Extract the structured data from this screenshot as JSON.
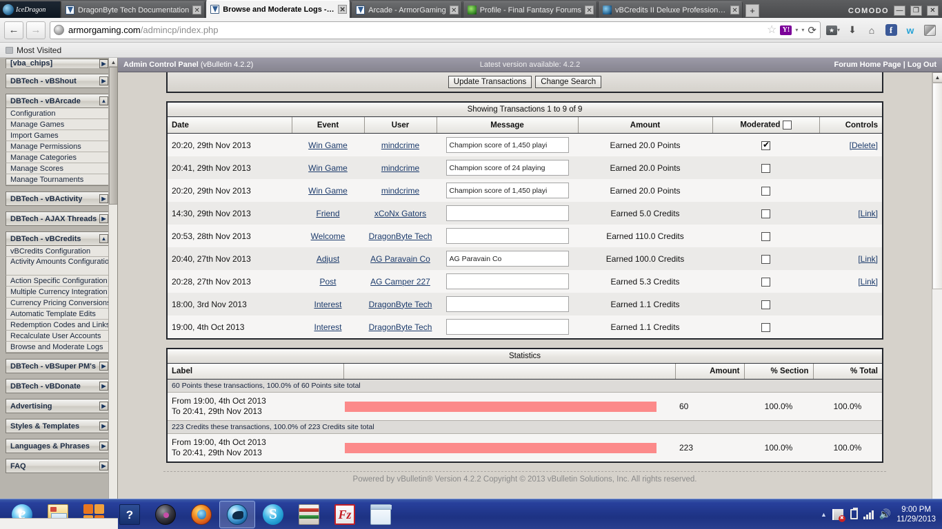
{
  "browser": {
    "brand_tab_label": "IceDragon",
    "tabs": [
      {
        "label": "DragonByte Tech Documentation",
        "favicon": "vbulletin-favicon",
        "active": false,
        "close_label": "✕"
      },
      {
        "label": "Browse and Moderate Logs - A...",
        "favicon": "vbulletin-favicon",
        "active": true,
        "close_label": "✕"
      },
      {
        "label": "Arcade - ArmorGaming",
        "favicon": "vbulletin-favicon",
        "active": false,
        "close_label": "✕"
      },
      {
        "label": "Profile - Final Fantasy Forums",
        "favicon": "green-globe-favicon",
        "active": false,
        "close_label": "✕"
      },
      {
        "label": "vBCredits II Deluxe Professional S...",
        "favicon": "blue-dragon-favicon",
        "active": false,
        "close_label": "✕"
      }
    ],
    "new_tab_label": "+",
    "comodo_label": "COMODO",
    "window_buttons": {
      "minimize": "—",
      "maximize": "❐",
      "close": "✕"
    },
    "nav": {
      "back_label": "←",
      "forward_label": "→",
      "url_domain": "armorgaming.com",
      "url_path": "/admincp/index.php",
      "star_label": "☆",
      "yahoo_label": "Y!",
      "caret_label": "▾",
      "reload_label": "⟳",
      "bookmarks_label": "★",
      "download_label": "⬇",
      "home_label": "⌂",
      "facebook_label": "f",
      "w_label": "w"
    },
    "bookmarks_bar": {
      "most_visited_label": "Most Visited"
    }
  },
  "acp": {
    "title_bold": "Admin Control Panel",
    "title_version": " (vBulletin 4.2.2)",
    "latest_version": "Latest version available: 4.2.2",
    "links_right": "Forum Home Page | Log Out"
  },
  "sidebar": {
    "clipped_top_label": "[vba_chips]",
    "blocks": [
      {
        "title": "DBTech - vBShout",
        "expanded": false,
        "arrow": "▶",
        "items": []
      },
      {
        "title": "DBTech - vBArcade",
        "expanded": true,
        "arrow": "▲",
        "items": [
          "Configuration",
          "Manage Games",
          "Import Games",
          "Manage Permissions",
          "Manage Categories",
          "Manage Scores",
          "Manage Tournaments"
        ]
      },
      {
        "title": "DBTech - vBActivity",
        "expanded": false,
        "arrow": "▶",
        "items": []
      },
      {
        "title": "DBTech - AJAX Threads",
        "expanded": false,
        "arrow": "▶",
        "items": []
      },
      {
        "title": "DBTech - vBCredits",
        "expanded": true,
        "arrow": "▲",
        "items": [
          "vBCredits Configuration",
          "Activity Amounts Configuration",
          "Action Specific Configuration",
          "Multiple Currency Integration",
          "Currency Pricing Conversions",
          "Automatic Template Edits",
          "Redemption Codes and Links",
          "Recalculate User Accounts",
          "Browse and Moderate Logs"
        ]
      },
      {
        "title": "DBTech - vBSuper PM's",
        "expanded": false,
        "arrow": "▶",
        "items": []
      },
      {
        "title": "DBTech - vBDonate",
        "expanded": false,
        "arrow": "▶",
        "items": []
      },
      {
        "title": "Advertising",
        "expanded": false,
        "arrow": "▶",
        "items": []
      },
      {
        "title": "Styles & Templates",
        "expanded": false,
        "arrow": "▶",
        "items": []
      },
      {
        "title": "Languages & Phrases",
        "expanded": false,
        "arrow": "▶",
        "items": []
      },
      {
        "title": "FAQ",
        "expanded": false,
        "arrow": "▶",
        "items": []
      }
    ]
  },
  "toolbar": {
    "update_transactions_label": "Update Transactions",
    "change_search_label": "Change Search"
  },
  "transactions": {
    "caption": "Showing Transactions 1 to 9 of 9",
    "columns": [
      "Date",
      "Event",
      "User",
      "Message",
      "Amount",
      "Moderated",
      "Controls"
    ],
    "rows": [
      {
        "date": "20:20, 29th Nov 2013",
        "event": "Win Game",
        "user": "mindcrime",
        "message": "Champion score of 1,450 playi",
        "amount": "Earned 20.0 Points",
        "moderated": true,
        "control": "[Delete]"
      },
      {
        "date": "20:41, 29th Nov 2013",
        "event": "Win Game",
        "user": "mindcrime",
        "message": "Champion score of 24 playing",
        "amount": "Earned 20.0 Points",
        "moderated": false,
        "control": ""
      },
      {
        "date": "20:20, 29th Nov 2013",
        "event": "Win Game",
        "user": "mindcrime",
        "message": "Champion score of 1,450 playi",
        "amount": "Earned 20.0 Points",
        "moderated": false,
        "control": ""
      },
      {
        "date": "14:30, 29th Nov 2013",
        "event": "Friend",
        "user": "xCoNx Gators",
        "message": "",
        "amount": "Earned 5.0 Credits",
        "moderated": false,
        "control": "[Link]"
      },
      {
        "date": "20:53, 28th Nov 2013",
        "event": "Welcome",
        "user": "DragonByte Tech",
        "message": "",
        "amount": "Earned 110.0 Credits",
        "moderated": false,
        "control": ""
      },
      {
        "date": "20:40, 27th Nov 2013",
        "event": "Adjust",
        "user": "AG Paravain Co",
        "message": "AG Paravain Co",
        "amount": "Earned 100.0 Credits",
        "moderated": false,
        "control": "[Link]"
      },
      {
        "date": "20:28, 27th Nov 2013",
        "event": "Post",
        "user": "AG Camper 227",
        "message": "",
        "amount": "Earned 5.3 Credits",
        "moderated": false,
        "control": "[Link]"
      },
      {
        "date": "18:00, 3rd Nov 2013",
        "event": "Interest",
        "user": "DragonByte Tech",
        "message": "",
        "amount": "Earned 1.1 Credits",
        "moderated": false,
        "control": ""
      },
      {
        "date": "19:00, 4th Oct 2013",
        "event": "Interest",
        "user": "DragonByte Tech",
        "message": "",
        "amount": "Earned 1.1 Credits",
        "moderated": false,
        "control": ""
      }
    ],
    "header_checkbox_checked": false
  },
  "statistics": {
    "caption": "Statistics",
    "columns": [
      "Label",
      "",
      "Amount",
      "% Section",
      "% Total"
    ],
    "sections": [
      {
        "note": "60 Points these transactions, 100.0% of 60 Points site total",
        "label_line1": "From 19:00, 4th Oct 2013",
        "label_line2": "To 20:41, 29th Nov 2013",
        "amount": "60",
        "pct_section": "100.0%",
        "pct_total": "100.0%",
        "bar_pct": 100
      },
      {
        "note": "223 Credits these transactions, 100.0% of 223 Credits site total",
        "label_line1": "From 19:00, 4th Oct 2013",
        "label_line2": "To 20:41, 29th Nov 2013",
        "amount": "223",
        "pct_section": "100.0%",
        "pct_total": "100.0%",
        "bar_pct": 100
      }
    ],
    "bar_color": "#fc8a8a"
  },
  "footer": {
    "text": "Powered by vBulletin® Version 4.2.2 Copyright © 2013 vBulletin Solutions, Inc. All rights reserved."
  },
  "taskbar": {
    "buttons": [
      {
        "name": "internet-explorer",
        "label": "e"
      },
      {
        "name": "windows-explorer",
        "label": ""
      },
      {
        "name": "microsoft-office",
        "label": ""
      },
      {
        "name": "help-document",
        "label": "?"
      },
      {
        "name": "media-disc",
        "label": ""
      },
      {
        "name": "firefox",
        "label": ""
      },
      {
        "name": "comodo-icedragon",
        "label": "",
        "active": true
      },
      {
        "name": "skype",
        "label": "S"
      },
      {
        "name": "winrar",
        "label": ""
      },
      {
        "name": "filezilla",
        "label": "Fz"
      },
      {
        "name": "notepad",
        "label": ""
      }
    ],
    "tray": {
      "caret": "▲",
      "speaker": "🔊",
      "time": "9:00 PM",
      "date": "11/29/2013"
    }
  },
  "scrollbars": {
    "up_arrow": "▲",
    "down_arrow": "▼",
    "left_arrow": "◀",
    "right_arrow": "▶"
  }
}
